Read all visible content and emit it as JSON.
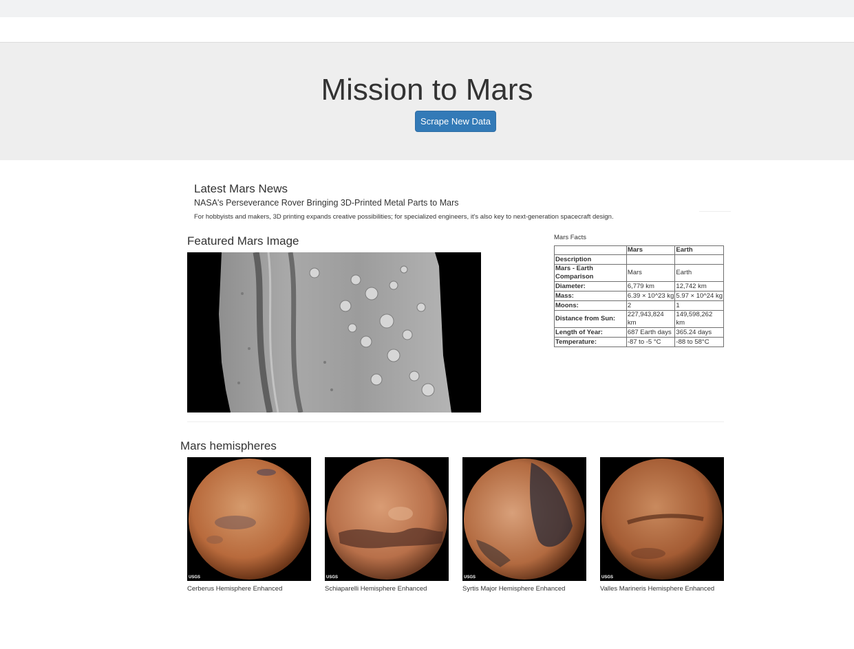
{
  "header": {
    "title": "Mission to Mars",
    "scrape_label": "Scrape New Data"
  },
  "news": {
    "section_title": "Latest Mars News",
    "headline": "NASA's Perseverance Rover Bringing 3D-Printed Metal Parts to Mars",
    "teaser": "For hobbyists and makers, 3D printing expands creative possibilities; for specialized engineers, it's also key to next-generation spacecraft design."
  },
  "featured": {
    "section_title": "Featured Mars Image"
  },
  "facts": {
    "caption": "Mars Facts",
    "columns": [
      "",
      "Mars",
      "Earth"
    ],
    "rows": [
      {
        "label": "Description",
        "mars": "",
        "earth": ""
      },
      {
        "label": "Mars - Earth Comparison",
        "mars": "Mars",
        "earth": "Earth"
      },
      {
        "label": "Diameter:",
        "mars": "6,779 km",
        "earth": "12,742 km"
      },
      {
        "label": "Mass:",
        "mars": "6.39 × 10^23 kg",
        "earth": "5.97 × 10^24 kg"
      },
      {
        "label": "Moons:",
        "mars": "2",
        "earth": "1"
      },
      {
        "label": "Distance from Sun:",
        "mars": "227,943,824 km",
        "earth": "149,598,262 km"
      },
      {
        "label": "Length of Year:",
        "mars": "687 Earth days",
        "earth": "365.24 days"
      },
      {
        "label": "Temperature:",
        "mars": "-87 to -5 °C",
        "earth": "-88 to 58°C"
      }
    ]
  },
  "hemispheres": {
    "section_title": "Mars hemispheres",
    "items": [
      {
        "title": "Cerberus Hemisphere Enhanced",
        "icon": "cerberus-hemisphere-image",
        "logo": "USGS"
      },
      {
        "title": "Schiaparelli Hemisphere Enhanced",
        "icon": "schiaparelli-hemisphere-image",
        "logo": "USGS"
      },
      {
        "title": "Syrtis Major Hemisphere Enhanced",
        "icon": "syrtis-major-hemisphere-image",
        "logo": "USGS"
      },
      {
        "title": "Valles Marineris Hemisphere Enhanced",
        "icon": "valles-marineris-hemisphere-image",
        "logo": "USGS"
      }
    ]
  },
  "colors": {
    "button": "#337ab7",
    "jumbotron": "#eeeeee",
    "mars_surface": "#c8784a"
  }
}
